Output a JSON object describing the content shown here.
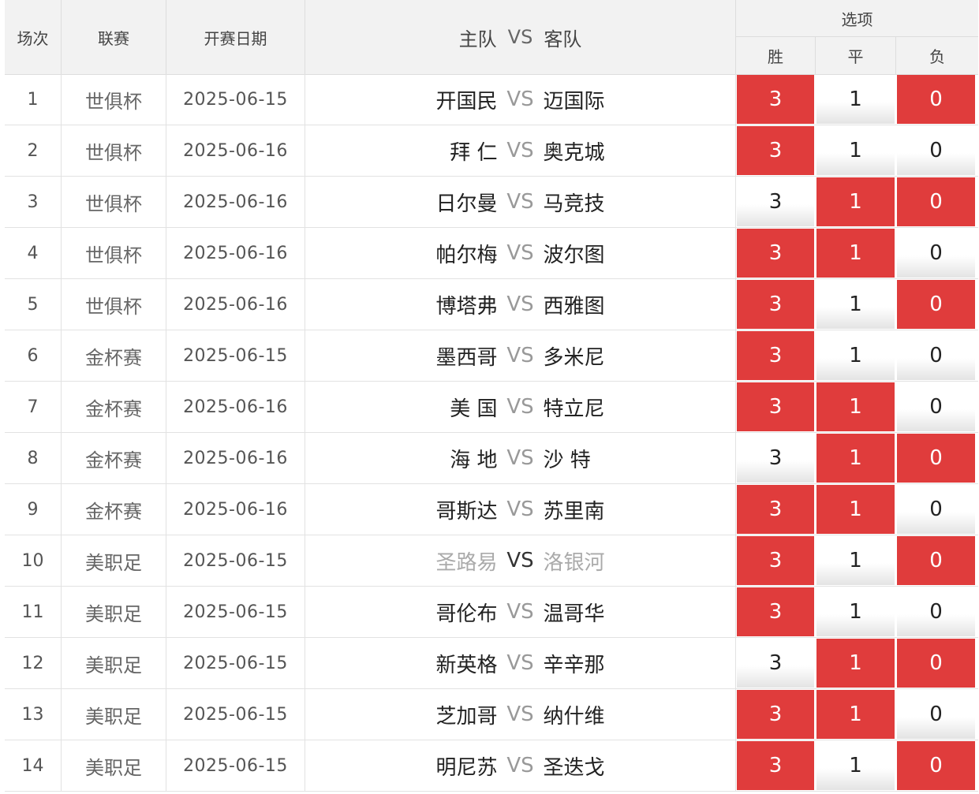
{
  "header": {
    "col_idx": "场次",
    "col_league": "联赛",
    "col_date": "开赛日期",
    "col_home": "主队",
    "col_vs": "VS",
    "col_away": "客队",
    "options_title": "选项",
    "opt_win": "胜",
    "opt_draw": "平",
    "opt_loss": "负"
  },
  "colors": {
    "selected": "#e03c3c",
    "header_bg": "#f2f2f2"
  },
  "rows": [
    {
      "idx": "1",
      "league": "世俱杯",
      "date": "2025-06-15",
      "home": "开国民",
      "vs": "VS",
      "away": "迈国际",
      "o3": "3",
      "o1": "1",
      "o0": "0",
      "sel3": true,
      "sel1": false,
      "sel0": true,
      "dim": false
    },
    {
      "idx": "2",
      "league": "世俱杯",
      "date": "2025-06-16",
      "home": "拜 仁",
      "vs": "VS",
      "away": "奥克城",
      "o3": "3",
      "o1": "1",
      "o0": "0",
      "sel3": true,
      "sel1": false,
      "sel0": false,
      "dim": false
    },
    {
      "idx": "3",
      "league": "世俱杯",
      "date": "2025-06-16",
      "home": "日尔曼",
      "vs": "VS",
      "away": "马竞技",
      "o3": "3",
      "o1": "1",
      "o0": "0",
      "sel3": false,
      "sel1": true,
      "sel0": true,
      "dim": false
    },
    {
      "idx": "4",
      "league": "世俱杯",
      "date": "2025-06-16",
      "home": "帕尔梅",
      "vs": "VS",
      "away": "波尔图",
      "o3": "3",
      "o1": "1",
      "o0": "0",
      "sel3": true,
      "sel1": true,
      "sel0": false,
      "dim": false
    },
    {
      "idx": "5",
      "league": "世俱杯",
      "date": "2025-06-16",
      "home": "博塔弗",
      "vs": "VS",
      "away": "西雅图",
      "o3": "3",
      "o1": "1",
      "o0": "0",
      "sel3": true,
      "sel1": false,
      "sel0": true,
      "dim": false
    },
    {
      "idx": "6",
      "league": "金杯赛",
      "date": "2025-06-15",
      "home": "墨西哥",
      "vs": "VS",
      "away": "多米尼",
      "o3": "3",
      "o1": "1",
      "o0": "0",
      "sel3": true,
      "sel1": false,
      "sel0": false,
      "dim": false
    },
    {
      "idx": "7",
      "league": "金杯赛",
      "date": "2025-06-16",
      "home": "美 国",
      "vs": "VS",
      "away": "特立尼",
      "o3": "3",
      "o1": "1",
      "o0": "0",
      "sel3": true,
      "sel1": true,
      "sel0": false,
      "dim": false
    },
    {
      "idx": "8",
      "league": "金杯赛",
      "date": "2025-06-16",
      "home": "海 地",
      "vs": "VS",
      "away": "沙 特",
      "o3": "3",
      "o1": "1",
      "o0": "0",
      "sel3": false,
      "sel1": true,
      "sel0": true,
      "dim": false
    },
    {
      "idx": "9",
      "league": "金杯赛",
      "date": "2025-06-16",
      "home": "哥斯达",
      "vs": "VS",
      "away": "苏里南",
      "o3": "3",
      "o1": "1",
      "o0": "0",
      "sel3": true,
      "sel1": true,
      "sel0": false,
      "dim": false
    },
    {
      "idx": "10",
      "league": "美职足",
      "date": "2025-06-15",
      "home": "圣路易",
      "vs": "VS",
      "away": "洛银河",
      "o3": "3",
      "o1": "1",
      "o0": "0",
      "sel3": true,
      "sel1": false,
      "sel0": true,
      "dim": true
    },
    {
      "idx": "11",
      "league": "美职足",
      "date": "2025-06-15",
      "home": "哥伦布",
      "vs": "VS",
      "away": "温哥华",
      "o3": "3",
      "o1": "1",
      "o0": "0",
      "sel3": true,
      "sel1": false,
      "sel0": false,
      "dim": false
    },
    {
      "idx": "12",
      "league": "美职足",
      "date": "2025-06-15",
      "home": "新英格",
      "vs": "VS",
      "away": "辛辛那",
      "o3": "3",
      "o1": "1",
      "o0": "0",
      "sel3": false,
      "sel1": true,
      "sel0": true,
      "dim": false
    },
    {
      "idx": "13",
      "league": "美职足",
      "date": "2025-06-15",
      "home": "芝加哥",
      "vs": "VS",
      "away": "纳什维",
      "o3": "3",
      "o1": "1",
      "o0": "0",
      "sel3": true,
      "sel1": true,
      "sel0": false,
      "dim": false
    },
    {
      "idx": "14",
      "league": "美职足",
      "date": "2025-06-15",
      "home": "明尼苏",
      "vs": "VS",
      "away": "圣迭戈",
      "o3": "3",
      "o1": "1",
      "o0": "0",
      "sel3": true,
      "sel1": false,
      "sel0": true,
      "dim": false
    }
  ]
}
